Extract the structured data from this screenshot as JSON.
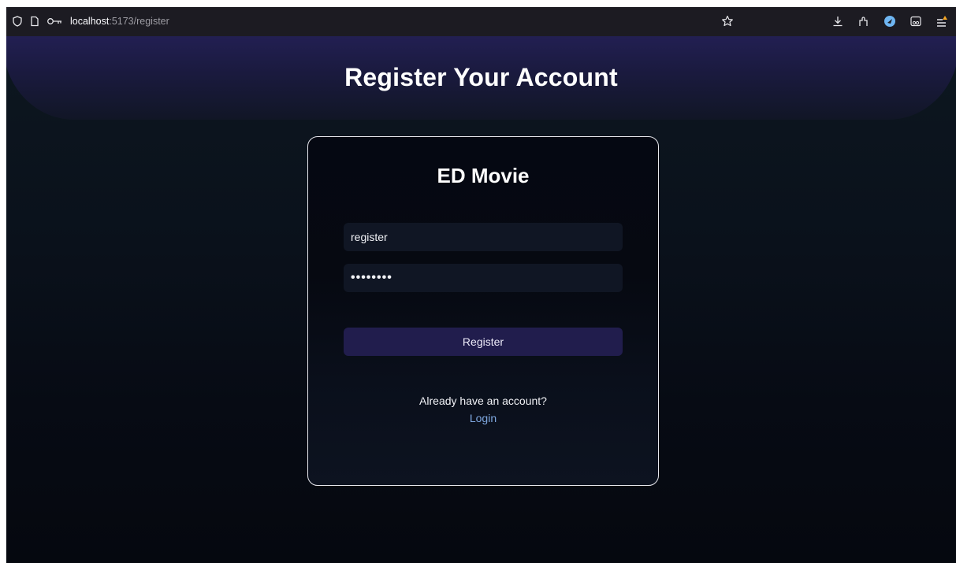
{
  "browser": {
    "url_host": "localhost",
    "url_path": ":5173/register"
  },
  "page": {
    "header_title": "Register Your Account",
    "card_title": "ED Movie",
    "username_value": "register",
    "password_value": "••••••••",
    "register_button": "Register",
    "already_text": "Already have an account?",
    "login_link": "Login"
  },
  "colors": {
    "page_background": "#070b14",
    "header_gradient_top": "#221f52",
    "button_background": "#211d4d",
    "link": "#7fa8e0",
    "card_border": "#e7e8ee"
  }
}
